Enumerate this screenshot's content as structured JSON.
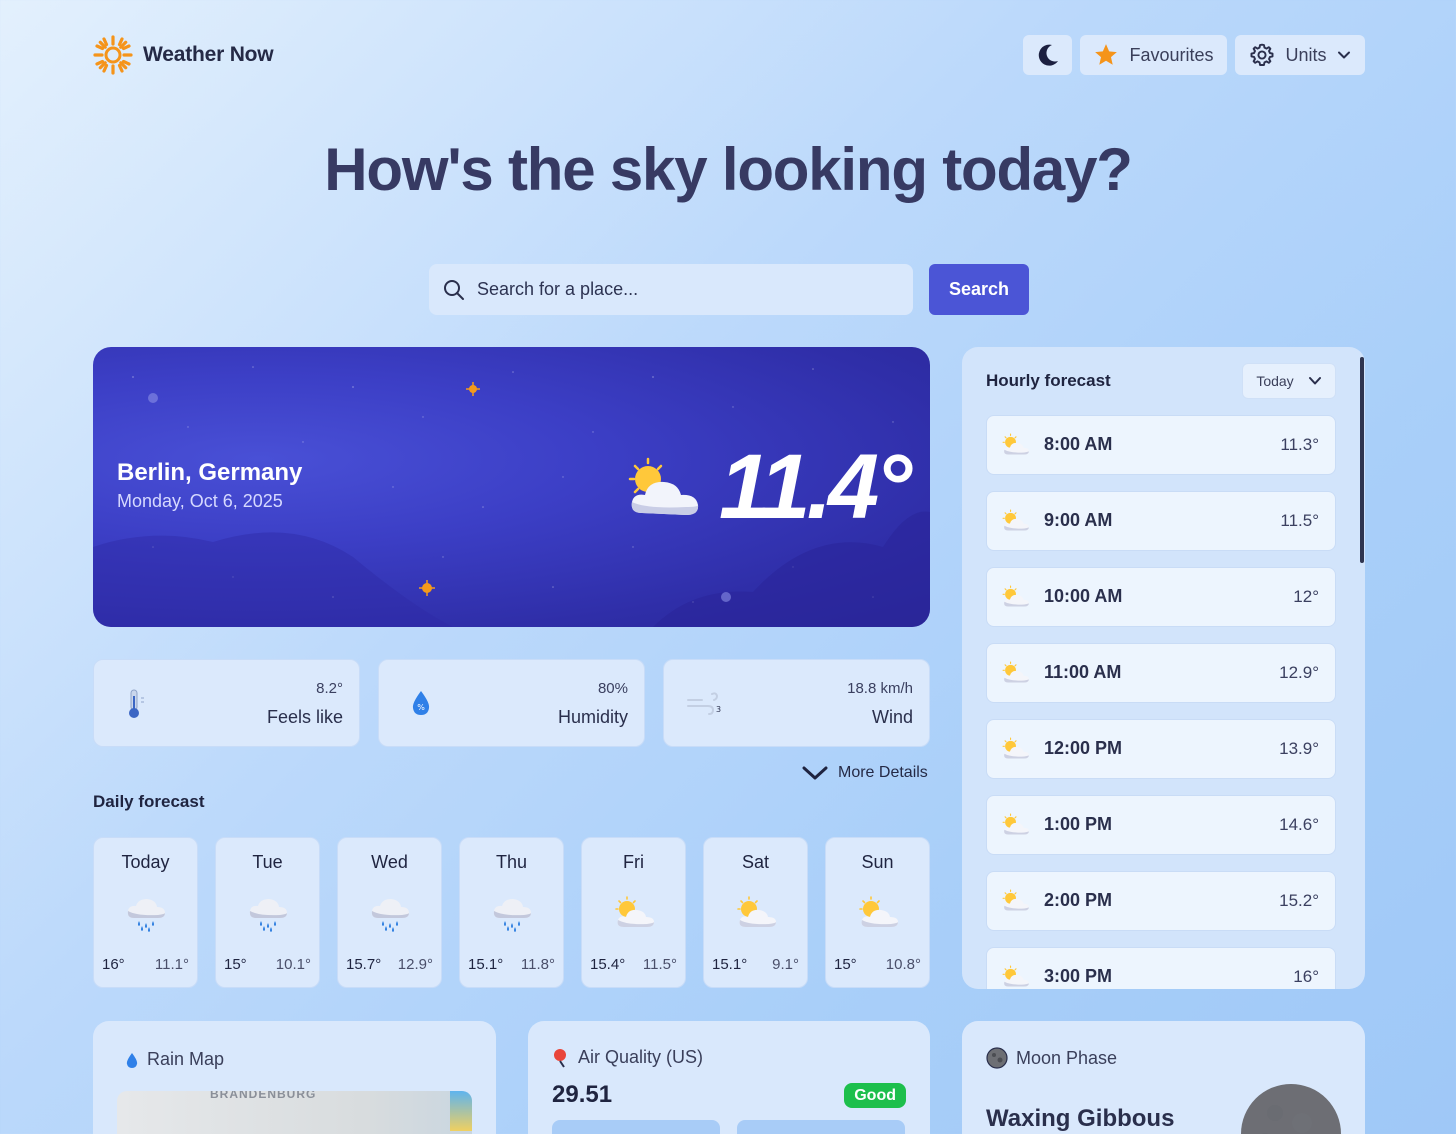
{
  "app": {
    "name": "Weather Now"
  },
  "header": {
    "favourites_label": "Favourites",
    "units_label": "Units"
  },
  "hero": {
    "title": "How's the sky looking today?"
  },
  "search": {
    "placeholder": "Search for a place...",
    "button_label": "Search"
  },
  "current": {
    "location": "Berlin, Germany",
    "date": "Monday, Oct 6, 2025",
    "temperature": "11.4°",
    "condition_icon": "partly-cloudy-day-icon"
  },
  "stats": [
    {
      "label": "Feels like",
      "value": "8.2°",
      "icon": "thermometer-icon"
    },
    {
      "label": "Humidity",
      "value": "80%",
      "icon": "humidity-drop-icon"
    },
    {
      "label": "Wind",
      "value": "18.8 km/h",
      "icon": "wind-icon"
    }
  ],
  "more_details_label": "More Details",
  "daily": {
    "title": "Daily forecast",
    "days": [
      {
        "name": "Today",
        "hi": "16°",
        "lo": "11.1°",
        "icon": "rain-cloud-icon"
      },
      {
        "name": "Tue",
        "hi": "15°",
        "lo": "10.1°",
        "icon": "rain-cloud-icon"
      },
      {
        "name": "Wed",
        "hi": "15.7°",
        "lo": "12.9°",
        "icon": "rain-cloud-icon"
      },
      {
        "name": "Thu",
        "hi": "15.1°",
        "lo": "11.8°",
        "icon": "rain-cloud-icon"
      },
      {
        "name": "Fri",
        "hi": "15.4°",
        "lo": "11.5°",
        "icon": "partly-cloudy-icon"
      },
      {
        "name": "Sat",
        "hi": "15.1°",
        "lo": "9.1°",
        "icon": "partly-cloudy-icon"
      },
      {
        "name": "Sun",
        "hi": "15°",
        "lo": "10.8°",
        "icon": "partly-cloudy-icon"
      }
    ]
  },
  "hourly": {
    "title": "Hourly forecast",
    "day_selector": "Today",
    "hours": [
      {
        "time": "8:00 AM",
        "temp": "11.3°"
      },
      {
        "time": "9:00 AM",
        "temp": "11.5°"
      },
      {
        "time": "10:00 AM",
        "temp": "12°"
      },
      {
        "time": "11:00 AM",
        "temp": "12.9°"
      },
      {
        "time": "12:00 PM",
        "temp": "13.9°"
      },
      {
        "time": "1:00 PM",
        "temp": "14.6°"
      },
      {
        "time": "2:00 PM",
        "temp": "15.2°"
      },
      {
        "time": "3:00 PM",
        "temp": "16°"
      }
    ]
  },
  "rain_map": {
    "title": "Rain Map",
    "map_label": "BRANDENBURG"
  },
  "air_quality": {
    "title": "Air Quality (US)",
    "value": "29.51",
    "status": "Good",
    "status_color": "#1dbf4c"
  },
  "moon": {
    "title": "Moon Phase",
    "phase": "Waxing Gibbous"
  },
  "colors": {
    "accent": "#4b55d6",
    "sun": "#f59a1b",
    "card": "#dbe9fc"
  }
}
